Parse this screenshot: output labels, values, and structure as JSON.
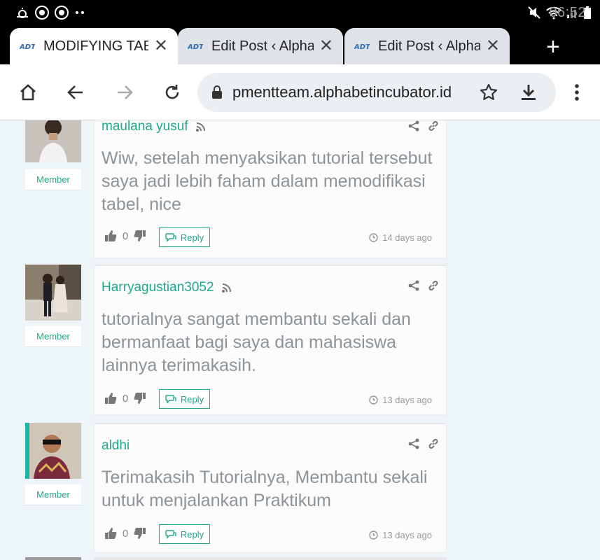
{
  "status_bar": {
    "time": "06:52",
    "notification_icons": [
      "weather-icon",
      "app-icon",
      "app-icon",
      "more-dots-icon"
    ],
    "right_icons": [
      "mute-icon",
      "wifi-icon",
      "signal-icon",
      "battery-icon"
    ]
  },
  "tabs": [
    {
      "title": "MODIFYING TAB",
      "active": true
    },
    {
      "title": "Edit Post ‹ Alpha",
      "active": false
    },
    {
      "title": "Edit Post ‹ Alpha",
      "active": false
    }
  ],
  "toolbar": {
    "url": "pmentteam.alphabetincubator.id"
  },
  "colors": {
    "accent": "#1fa98a",
    "comment_text": "#8c9399",
    "page_bg": "#eef5f8"
  },
  "comments": [
    {
      "author": "maulana yusuf",
      "role": "Member",
      "text": "Wiw, setelah menyaksikan tutorial tersebut saya jadi lebih faham dalam memodifikasi tabel, nice",
      "votes": "0",
      "reply_label": "Reply",
      "time": "14 days ago"
    },
    {
      "author": "Harryagustian3052",
      "role": "Member",
      "text": "tutorialnya sangat membantu sekali dan bermanfaat bagi saya dan mahasiswa lainnya terimakasih.",
      "votes": "0",
      "reply_label": "Reply",
      "time": "13 days ago"
    },
    {
      "author": "aldhi",
      "role": "Member",
      "text": "Terimakasih Tutorialnya, Membantu sekali untuk menjalankan Praktikum",
      "votes": "0",
      "reply_label": "Reply",
      "time": "13 days ago"
    }
  ]
}
